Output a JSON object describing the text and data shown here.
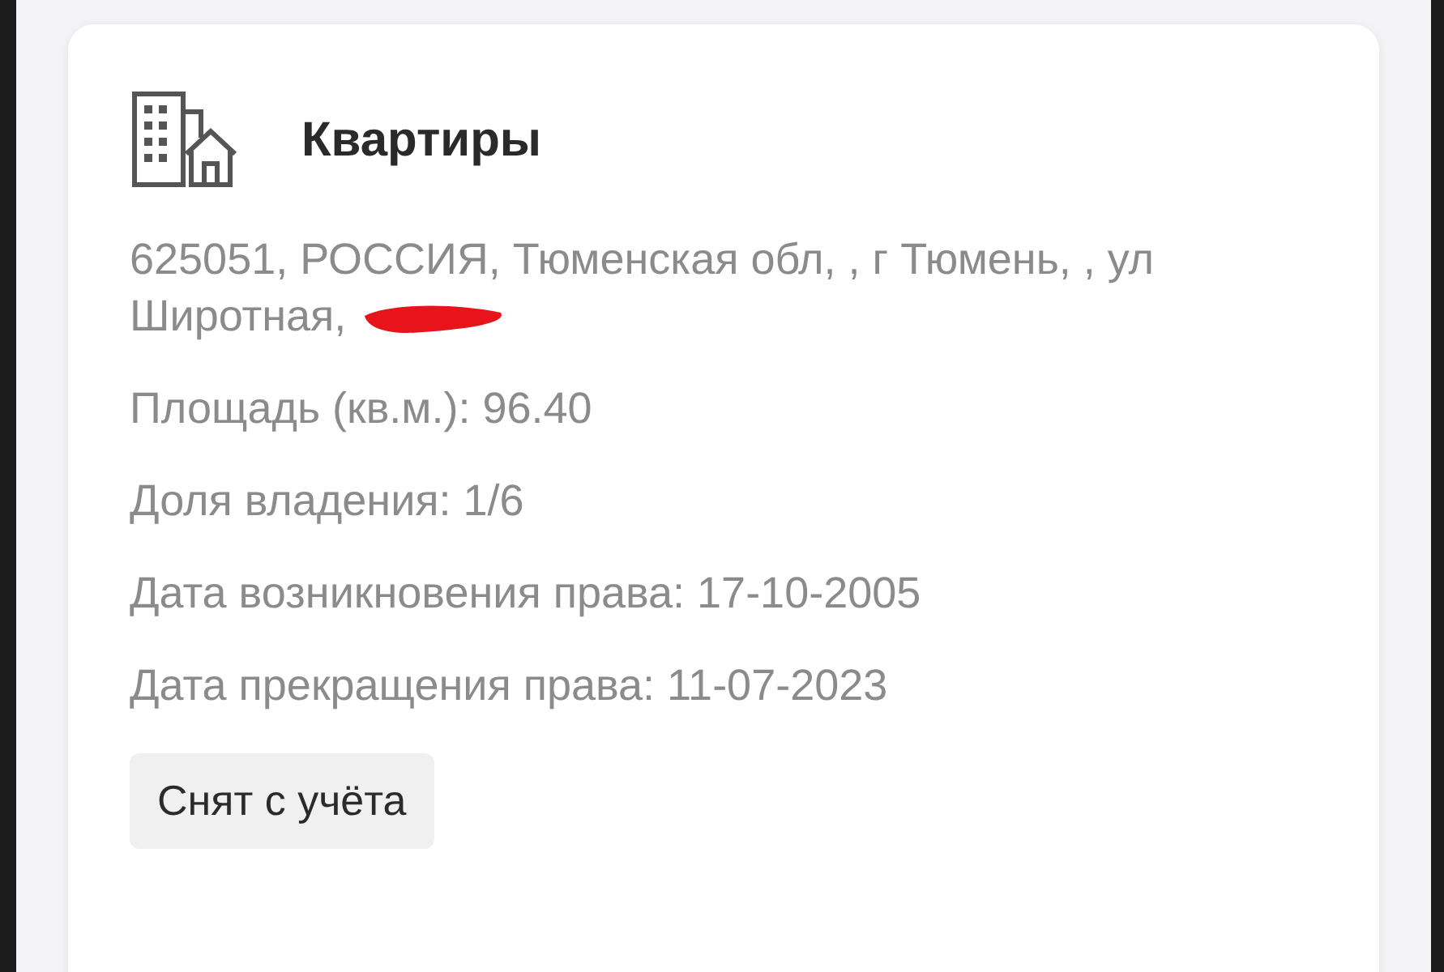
{
  "section": {
    "title": "Квартиры"
  },
  "address": "625051, РОССИЯ, Тюменская обл, , г Тюмень, , ул Широтная,",
  "address_redacted": true,
  "details": [
    "Площадь (кв.м.): 96.40",
    "Доля владения: 1/6",
    "Дата возникновения права: 17-10-2005",
    "Дата прекращения права: 11-07-2023"
  ],
  "status_badge": "Снят с учёта"
}
